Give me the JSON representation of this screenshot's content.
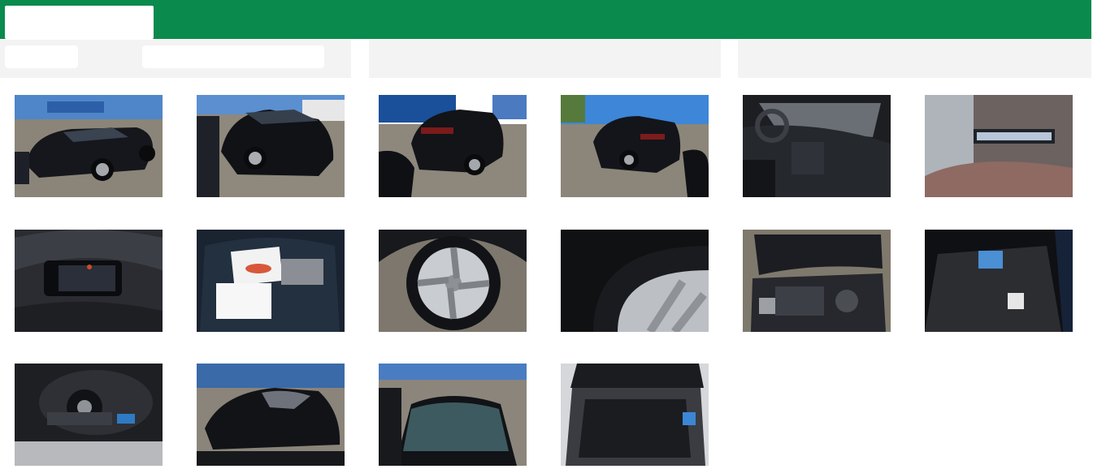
{
  "header": {
    "brand_color": "#0a8a4c",
    "logo": ""
  },
  "filter_bar": {
    "left_panel": {
      "button_label": "",
      "search_placeholder": ""
    },
    "middle_panel_label": "",
    "right_panel_label": ""
  },
  "gallery": {
    "photos": [
      {
        "subject": "car-front-three-quarter-left"
      },
      {
        "subject": "car-front-three-quarter-right"
      },
      {
        "subject": "car-rear-three-quarter-left"
      },
      {
        "subject": "car-rear-three-quarter-right"
      },
      {
        "subject": "interior-dashboard"
      },
      {
        "subject": "vin-plate"
      },
      {
        "subject": "instrument-cluster"
      },
      {
        "subject": "documents-on-seat"
      },
      {
        "subject": "wheel-closeup"
      },
      {
        "subject": "tyre-closeup"
      },
      {
        "subject": "engine-bay"
      },
      {
        "subject": "trunk-floor"
      },
      {
        "subject": "spare-wheel-well"
      },
      {
        "subject": "roof-view"
      },
      {
        "subject": "windscreen-view"
      },
      {
        "subject": "open-trunk"
      }
    ]
  }
}
